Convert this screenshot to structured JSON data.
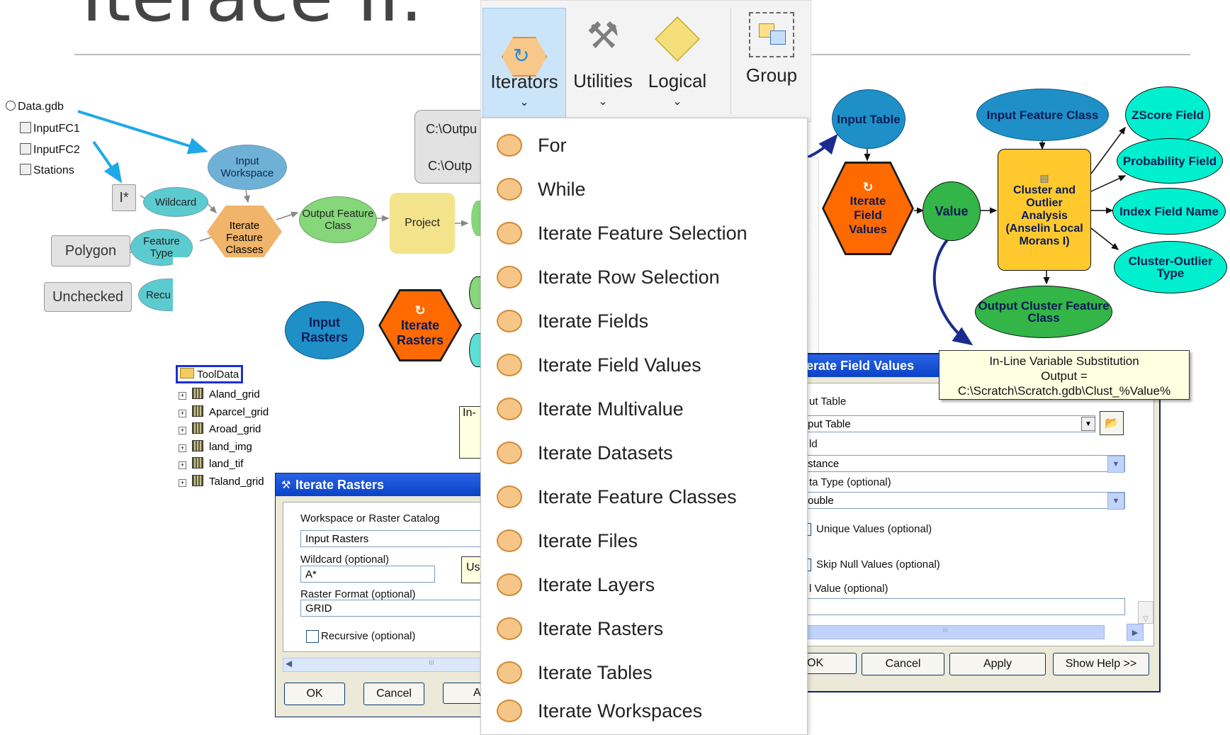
{
  "slide": {
    "title": "Iterace II."
  },
  "model_left": {
    "tree": {
      "root": "Data.gdb",
      "items": [
        "InputFC1",
        "InputFC2",
        "Stations"
      ]
    },
    "wildcard_value": "I*",
    "nodes": {
      "input_workspace": "Input Workspace",
      "wildcard": "Wildcard",
      "feature_type": "Feature Type",
      "iterate_feature_classes": "Iterate Feature Classes",
      "output_feature_class": "Output Feature Class",
      "project": "Project",
      "recursive_partial": "Recu"
    },
    "values": {
      "polygon": "Polygon",
      "unchecked": "Unchecked",
      "path1": "C:\\Outpu",
      "path2": "C:\\Outp"
    }
  },
  "model_rasters": {
    "folder": "ToolData",
    "rasters": [
      "Aland_grid",
      "Aparcel_grid",
      "Aroad_grid",
      "land_img",
      "land_tif",
      "Taland_grid"
    ],
    "input_rasters": "Input Rasters",
    "iterate_rasters": "Iterate Rasters",
    "partial_label": "In-"
  },
  "dialog_rasters": {
    "title": "Iterate Rasters",
    "fields": [
      {
        "label": "Workspace or Raster Catalog",
        "value": "Input Rasters"
      },
      {
        "label": "Wildcard (optional)",
        "value": "A*"
      },
      {
        "label": "Raster Format (optional)",
        "value": "GRID"
      }
    ],
    "checkbox": "Recursive (optional)",
    "tooltip_partial": "Us",
    "buttons": {
      "ok": "OK",
      "cancel": "Cancel",
      "partial": "A"
    },
    "scroll_mark": "III"
  },
  "ribbon": {
    "buttons": [
      {
        "label": "Iterators",
        "icon": "iterator-icon",
        "selected": true
      },
      {
        "label": "Utilities",
        "icon": "hammer-icon",
        "selected": false
      },
      {
        "label": "Logical",
        "icon": "logical-icon",
        "selected": false
      },
      {
        "label": "Group",
        "icon": "group-icon",
        "selected": false
      }
    ]
  },
  "menu": {
    "items": [
      "For",
      "While",
      "Iterate Feature Selection",
      "Iterate Row Selection",
      "Iterate Fields",
      "Iterate Field Values",
      "Iterate Multivalue",
      "Iterate Datasets",
      "Iterate Feature Classes",
      "Iterate Files",
      "Iterate Layers",
      "Iterate Rasters",
      "Iterate Tables",
      "Iterate Workspaces"
    ]
  },
  "bg_panel": {
    "partial_title": "Fo",
    "partial_letters": [
      "It",
      "v",
      "e",
      "p",
      "e",
      "c"
    ]
  },
  "model_right": {
    "input_table": "Input Table",
    "input_feature_class": "Input Feature Class",
    "iterate_field_values": "Iterate Field Values",
    "value": "Value",
    "cluster": "Cluster and Outlier Analysis (Anselin Local Morans I)",
    "outputs": [
      "ZScore Field",
      "Probability Field",
      "Index Field Name",
      "Cluster-Outlier Type"
    ],
    "output_cluster": "Output Cluster Feature Class",
    "callout": {
      "line1": "In-Line Variable Substitution",
      "line2": "Output =",
      "line3": "C:\\Scratch\\Scratch.gdb\\Clust_%Value%"
    }
  },
  "dialog_fieldvalues": {
    "title": "erate Field Values",
    "rows": [
      {
        "label": "ut Table",
        "value": "put Table"
      },
      {
        "label": "ld",
        "value": "stance"
      },
      {
        "label": "ta Type (optional)",
        "value": "ouble"
      }
    ],
    "check1": "Unique Values (optional)",
    "check2": "Skip Null Values (optional)",
    "null_label": "l Value (optional)",
    "scroll_mark": "III",
    "buttons": [
      "OK",
      "Cancel",
      "Apply",
      "Show Help >>"
    ]
  },
  "colors": {
    "accent_blue": "#1f4fa3",
    "orange": "#ff6a00",
    "ribbon_sel": "#cce4f7"
  }
}
